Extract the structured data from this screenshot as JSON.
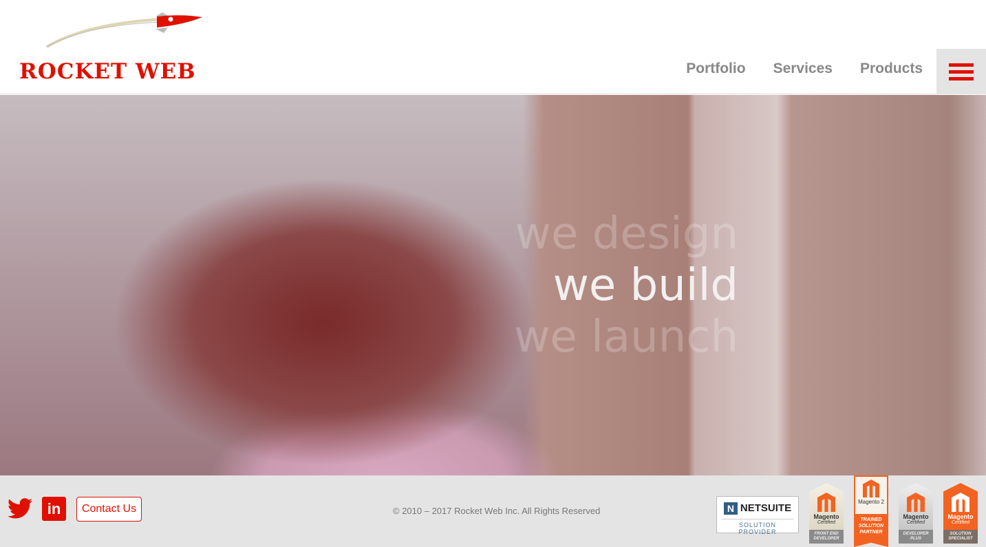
{
  "header": {
    "logo_text": "ROCKET WEB",
    "nav": [
      {
        "label": "Portfolio"
      },
      {
        "label": "Services"
      },
      {
        "label": "Products"
      }
    ],
    "menu_icon": "hamburger-icon",
    "brand_color": "#e01000"
  },
  "hero": {
    "lines": [
      "we design",
      "we build",
      "we launch"
    ]
  },
  "footer": {
    "twitter_icon": "twitter-icon",
    "linkedin_icon": "linkedin-icon",
    "linkedin_glyph": "in",
    "contact_label": "Contact Us",
    "copyright": "© 2010 – 2017 Rocket Web Inc. All Rights Reserved",
    "netsuite": {
      "name": "NETSUITE",
      "sub": "SOLUTION PROVIDER"
    },
    "badges": [
      {
        "name": "Magento",
        "cert": "Certified",
        "sub": "FRONT END DEVELOPER"
      },
      {
        "name": "Magento 2",
        "sub": "TRAINED SOLUTION PARTNER"
      },
      {
        "name": "Magento",
        "cert": "Certified",
        "sub": "DEVELOPER PLUS"
      },
      {
        "name": "Magento",
        "cert": "Certified",
        "sub": "SOLUTION SPECIALIST"
      }
    ]
  }
}
